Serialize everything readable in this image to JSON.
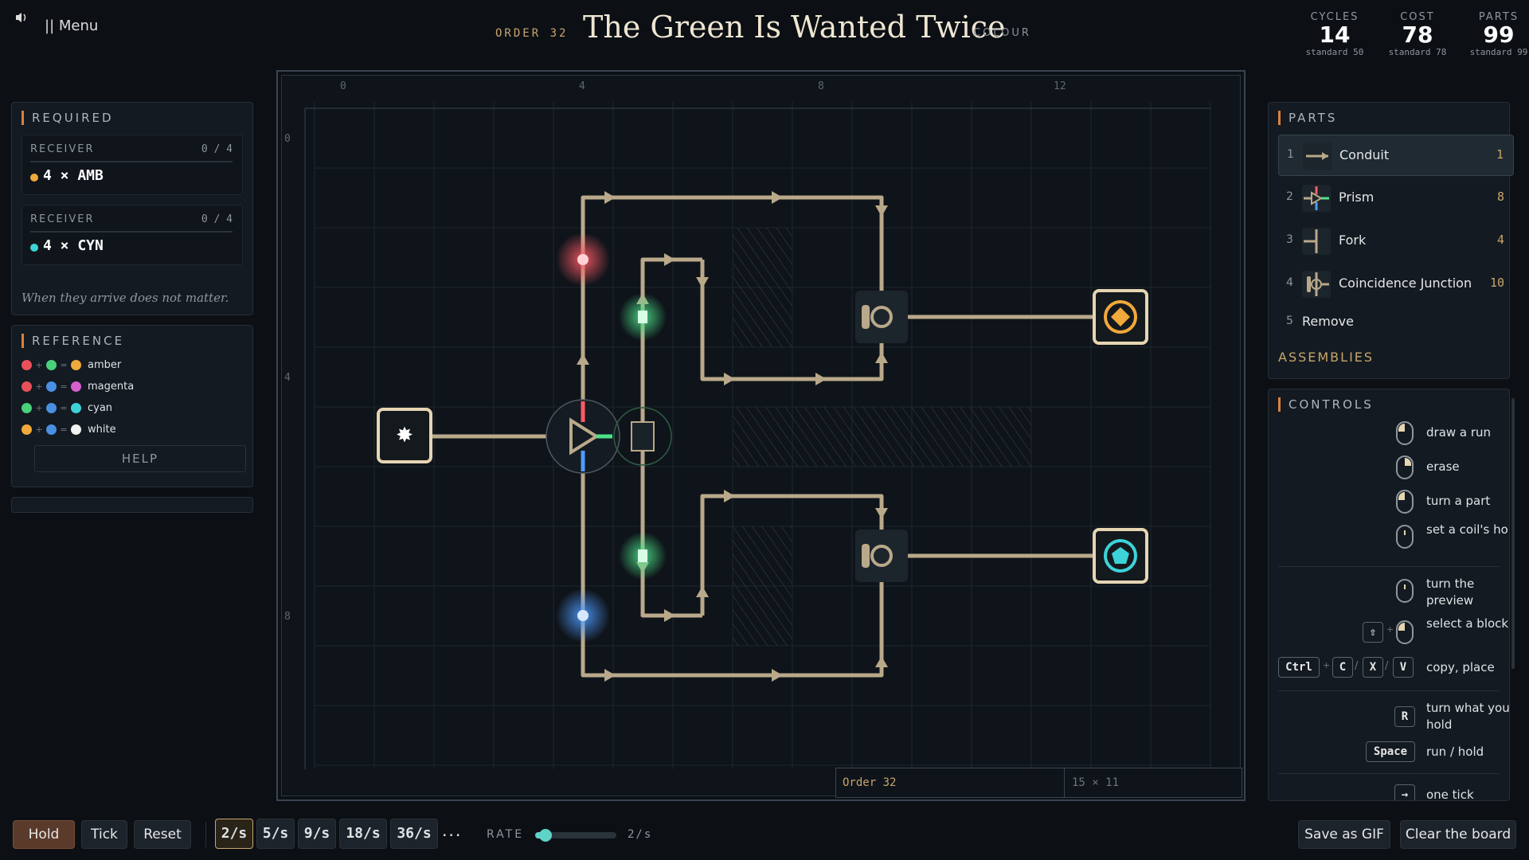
{
  "header": {
    "sound_icon": "speaker-icon",
    "menu_label": "|| Menu",
    "order_label": "ORDER 32",
    "title": "The Green Is Wanted Twice",
    "category": "COLOUR"
  },
  "stats": [
    {
      "label": "CYCLES",
      "value": "14",
      "standard": "standard 50"
    },
    {
      "label": "COST",
      "value": "78",
      "standard": "standard 78"
    },
    {
      "label": "PARTS",
      "value": "99",
      "standard": "standard 99"
    }
  ],
  "required": {
    "title": "REQUIRED",
    "receivers": [
      {
        "label": "RECEIVER",
        "count": "0 / 4",
        "quantity": "4 × AMB",
        "color": "#f0a93a"
      },
      {
        "label": "RECEIVER",
        "count": "0 / 4",
        "quantity": "4 × CYN",
        "color": "#3cd3d8"
      }
    ],
    "note": "When they arrive does not matter."
  },
  "reference": {
    "title": "REFERENCE",
    "rows": [
      {
        "a": "#e8505b",
        "b": "#4bd07a",
        "result": "#f0a93a",
        "name": "amber"
      },
      {
        "a": "#e8505b",
        "b": "#4a90e2",
        "result": "#d65fd0",
        "name": "magenta"
      },
      {
        "a": "#4bd07a",
        "b": "#4a90e2",
        "result": "#3cd3d8",
        "name": "cyan"
      },
      {
        "a": "#f0a93a",
        "b": "#4a90e2",
        "result": "#f2f2f2",
        "name": "white"
      }
    ],
    "plus": "+",
    "equals": "=",
    "help_label": "HELP"
  },
  "board": {
    "col_labels": [
      "0",
      "4",
      "8",
      "12"
    ],
    "row_labels": [
      "0",
      "4",
      "8"
    ],
    "footer_name": "Order 32",
    "footer_size": "15 × 11",
    "colors": {
      "conduit": "#b9a98a",
      "red": "#ff5b66",
      "green": "#4de28a",
      "blue": "#4f9bff",
      "amber": "#f0a93a",
      "cyan": "#3cd3d8"
    }
  },
  "parts": {
    "title": "PARTS",
    "items": [
      {
        "num": "1",
        "name": "Conduit",
        "count": "1",
        "icon": "conduit-icon"
      },
      {
        "num": "2",
        "name": "Prism",
        "count": "8",
        "icon": "prism-icon"
      },
      {
        "num": "3",
        "name": "Fork",
        "count": "4",
        "icon": "fork-icon"
      },
      {
        "num": "4",
        "name": "Coincidence Junction",
        "count": "10",
        "icon": "junction-icon"
      }
    ],
    "remove": {
      "num": "5",
      "name": "Remove"
    },
    "assemblies_label": "ASSEMBLIES"
  },
  "controls": {
    "title": "CONTROLS",
    "items": [
      {
        "label": "draw a run"
      },
      {
        "label": "erase"
      },
      {
        "label": "turn a part"
      },
      {
        "label": "set a coil's hold"
      },
      {
        "label": "turn the preview"
      },
      {
        "label": "select a block",
        "key": "⇧",
        "plus": "+"
      },
      {
        "label": "copy, place",
        "keys": [
          "Ctrl",
          "C",
          "X",
          "V"
        ],
        "plus": "+",
        "slash": "/"
      },
      {
        "label": "turn what you hold",
        "key": "R"
      },
      {
        "label": "run / hold",
        "key": "Space"
      },
      {
        "label": "one tick",
        "key": "→"
      }
    ]
  },
  "bottom": {
    "hold": "Hold",
    "tick": "Tick",
    "reset": "Reset",
    "speeds": [
      "2/s",
      "5/s",
      "9/s",
      "18/s",
      "36/s",
      "..."
    ],
    "rate_label": "RATE",
    "rate_value": "2/s",
    "rate_fraction": 0.05,
    "save_gif": "Save as GIF",
    "clear_board": "Clear the board"
  }
}
